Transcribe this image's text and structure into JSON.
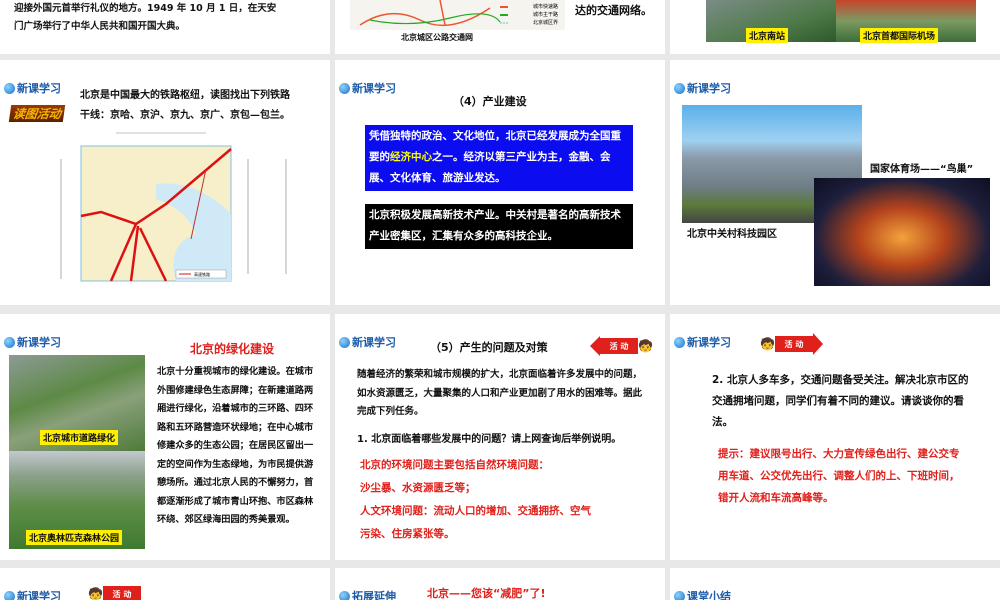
{
  "badges": {
    "new_learning": "新课学习",
    "extension": "拓展延伸",
    "summary": "课堂小结",
    "read_map": "读图活动",
    "activity": "活 动"
  },
  "row0": {
    "s1_lines": [
      "迎接外国元首举行礼仪的地方。1949 年 10 月 1 日，在天安",
      "门广场举行了中华人民共和国开国大典。"
    ],
    "s2_caption": "北京城区公路交通网",
    "s2_legend": [
      "城市快速路",
      "城市主干路",
      "北京城区界"
    ],
    "s2_text": "达的交通网络。",
    "s3_captions": [
      "北京南站",
      "北京首都国际机场"
    ]
  },
  "slide_rail": {
    "lines": [
      "北京是中国最大的铁路枢纽，读图找出下列铁路",
      "干线：京哈、京沪、京九、京广、京包—包兰。"
    ],
    "legend": "高速铁路"
  },
  "slide_industry": {
    "title": "（4）产业建设",
    "blue_pre": "凭借独特的政治、文化地位，北京已经发展成为全国重要的",
    "blue_hl": "经济中心",
    "blue_post": "之一。经济以第三产业为主，金融、会展、文化体育、旅游业发达。",
    "black": "北京积极发展高新技术产业。中关村是著名的高新技术产业密集区，汇集有众多的高科技企业。"
  },
  "slide_photos": {
    "cap1": "北京中关村科技园区",
    "cap2": "国家体育场——“鸟巢”"
  },
  "slide_green": {
    "title": "北京的绿化建设",
    "body": "北京十分重视城市的绿化建设。在城市外围修建绿色生态屏障；在新建道路两厢进行绿化，沿着城市的三环路、四环路和五环路营造环状绿地；在中心城市修建众多的生态公园；在居民区留出一定的空间作为生态绿地，为市民提供游憩场所。通过北京人民的不懈努力，首都逐渐形成了城市青山环抱、市区森林环绕、郊区绿海田园的秀美景观。",
    "cap1": "北京城市道路绿化",
    "cap2": "北京奥林匹克森林公园"
  },
  "slide_problems": {
    "title": "（5）产生的问题及对策",
    "intro": "随着经济的繁荣和城市规模的扩大，北京面临着许多发展中的问题，如水资源匮乏，大量聚集的人口和产业更加剧了用水的困难等。据此完成下列任务。",
    "q1": "1. 北京面临着哪些发展中的问题？请上网查询后举例说明。",
    "a1": [
      "北京的环境问题主要包括自然环境问题：",
      "沙尘暴、水资源匮乏等；",
      "人文环境问题：流动人口的增加、交通拥挤、空气",
      "污染、住房紧张等。"
    ]
  },
  "slide_traffic": {
    "q2": "2. 北京人多车多，交通问题备受关注。解决北京市区的交通拥堵问题，同学们有着不同的建议。请谈谈你的看法。",
    "hint": "提示：建议限号出行、大力宣传绿色出行、建公交专用车道、公交优先出行、调整人们的上、下班时间，错开人流和车流高峰等。"
  },
  "row4": {
    "s2_title": "北京——您该“减肥”了!"
  }
}
